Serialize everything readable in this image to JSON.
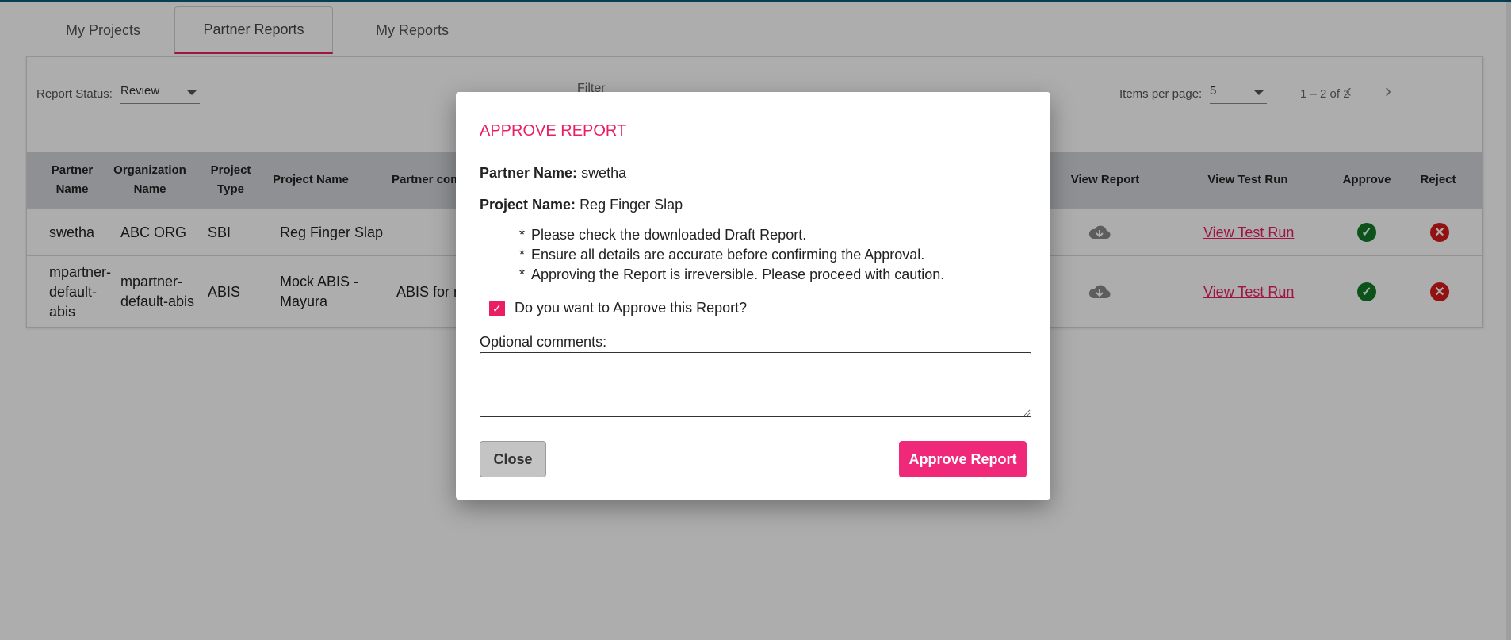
{
  "tabs": [
    {
      "label": "My Projects"
    },
    {
      "label": "Partner Reports",
      "active": true
    },
    {
      "label": "My Reports"
    }
  ],
  "toolbar": {
    "report_status_label": "Report Status:",
    "report_status_value": "Review",
    "filter_label": "Filter",
    "items_per_page_label": "Items per page:",
    "items_per_page_value": "5",
    "range_label": "1 – 2 of 2"
  },
  "table": {
    "headers": {
      "partner_name": "Partner Name",
      "organization_name": "Organization Name",
      "project_type": "Project Type",
      "project_name": "Project Name",
      "partner_comments": "Partner com",
      "view_report": "View Report",
      "view_test_run": "View Test Run",
      "approve": "Approve",
      "reject": "Reject"
    },
    "rows": [
      {
        "partner_name": "swetha",
        "organization_name": "ABC ORG",
        "project_type": "SBI",
        "project_name": "Reg Finger Slap",
        "partner_comments": "",
        "view_test_run": "View Test Run"
      },
      {
        "partner_name": "mpartner-default-abis",
        "organization_name": "mpartner-default-abis",
        "project_type": "ABIS",
        "project_name": "Mock ABIS - Mayura",
        "partner_comments": "ABIS for r",
        "view_test_run": "View Test Run"
      }
    ]
  },
  "dialog": {
    "title": "APPROVE REPORT",
    "partner_name_label": "Partner Name:",
    "partner_name_value": "swetha",
    "project_name_label": "Project Name:",
    "project_name_value": "Reg Finger Slap",
    "notes": [
      "Please check the downloaded Draft Report.",
      "Ensure all details are accurate before confirming the Approval.",
      "Approving the Report is irreversible. Please proceed with caution."
    ],
    "note_marker": "*",
    "checkbox_label": "Do you want to Approve this Report?",
    "checkbox_checked": true,
    "comments_label": "Optional comments:",
    "comments_value": "",
    "close_label": "Close",
    "approve_label": "Approve Report"
  },
  "colors": {
    "accent": "#e91e63",
    "approve_button": "#f0287a",
    "approve_icon": "#137b25",
    "reject_icon": "#d81b1b",
    "header_bg": "#d1d4d9"
  },
  "icons": {
    "view_report": "cloud-download-icon",
    "approve": "check-circle-icon",
    "reject": "x-circle-icon"
  }
}
